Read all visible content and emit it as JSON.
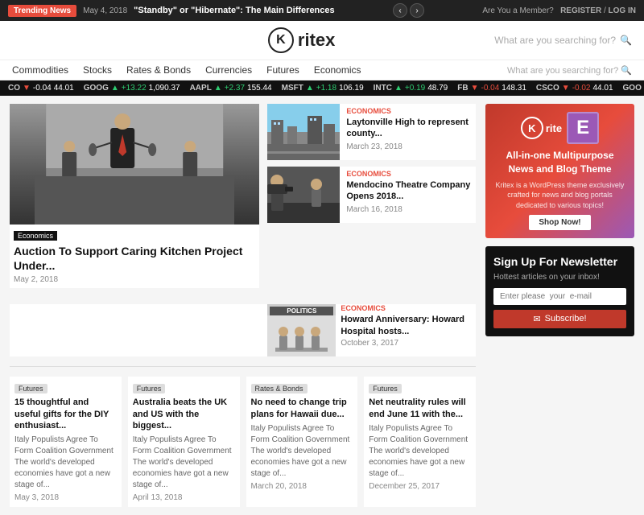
{
  "topbar": {
    "trending_label": "Trending News",
    "date": "May 4, 2018",
    "headline": "\"Standby\" or \"Hibernate\": The Main Differences",
    "member_text": "Are You a Member?",
    "register": "REGISTER",
    "separator": "/",
    "login": "LOG IN"
  },
  "header": {
    "logo_text": "K",
    "logo_name": "ritex",
    "search_placeholder": "What are you searching for?"
  },
  "nav": {
    "links": [
      "Commodities",
      "Stocks",
      "Rates & Bonds",
      "Currencies",
      "Futures",
      "Economics"
    ],
    "search_label": "What are you searching for?"
  },
  "ticker": [
    {
      "sym": "CO",
      "change": "-0.04",
      "val": "44.01",
      "dir": "down"
    },
    {
      "sym": "GOOG",
      "change": "+13.22",
      "val": "1,090.37",
      "dir": "up"
    },
    {
      "sym": "AAPL",
      "change": "+2.37",
      "val": "155.44",
      "dir": "up"
    },
    {
      "sym": "MSFT",
      "change": "+1.18",
      "val": "106.19",
      "dir": "up"
    },
    {
      "sym": "INTC",
      "change": "+0.19",
      "val": "48.79",
      "dir": "up"
    },
    {
      "sym": "FB",
      "change": "-0.04",
      "val": "148.31",
      "dir": "down"
    },
    {
      "sym": "CSCO",
      "change": "-0.02",
      "val": "44.01",
      "dir": "down"
    },
    {
      "sym": "GOO",
      "change": "",
      "val": "",
      "dir": ""
    }
  ],
  "featured_main": {
    "tag": "Economics",
    "title": "Auction To Support Caring Kitchen Project Under...",
    "date": "May 2, 2018"
  },
  "featured_right": [
    {
      "tag": "Economics",
      "title": "Laytonville High to represent county...",
      "date": "March 23, 2018"
    },
    {
      "tag": "Economics",
      "title": "Mendocino Theatre Company Opens 2018...",
      "date": "March 16, 2018"
    }
  ],
  "side_cards": [
    {
      "tag": "Economics",
      "title": "Howard Anniversary: Howard Hospital hosts...",
      "date": "October 3, 2017",
      "has_politics_banner": false
    }
  ],
  "politics_card": {
    "tag": "Economics",
    "title": "Howard Anniversary: Howard Hospital hosts...",
    "date": "October 3, 2017",
    "banner": "POLITICS"
  },
  "small_cards": [
    {
      "tag": "Futures",
      "title": "15 thoughtful and useful gifts for the DIY enthusiast...",
      "desc": "Italy Populists Agree To Form Coalition Government The world's developed economies have got a new stage of...",
      "date": "May 3, 2018"
    },
    {
      "tag": "Futures",
      "title": "Australia beats the UK and US with the biggest...",
      "desc": "Italy Populists Agree To Form Coalition Government The world's developed economies have got a new stage of...",
      "date": "April 13, 2018"
    },
    {
      "tag": "Rates & Bonds",
      "title": "No need to change trip plans for Hawaii due...",
      "desc": "Italy Populists Agree To Form Coalition Government The world's developed economies have got a new stage of...",
      "date": "March 20, 2018"
    },
    {
      "tag": "Futures",
      "title": "Net neutrality rules will end June 11 with the...",
      "desc": "Italy Populists Agree To Form Coalition Government The world's developed economies have got a new stage of...",
      "date": "December 25, 2017"
    }
  ],
  "sidebar": {
    "ad": {
      "logo_text": "K",
      "logo_name": "rite",
      "e_icon": "E",
      "title": "All-in-one Multipurpose News and Blog Theme",
      "desc": "Kritex is a WordPress theme exclusively crafted for news and blog portals dedicated to various topics!",
      "btn": "Shop Now!"
    },
    "newsletter": {
      "title": "Sign Up For Newsletter",
      "subtitle": "Hottest articles on your inbox!",
      "placeholder": "Enter please  your  e-mail",
      "btn_label": "Subscribe!",
      "btn_icon": "✉"
    }
  },
  "colors": {
    "accent": "#e74c3c",
    "dark": "#111111",
    "ad_gradient_start": "#c0392b",
    "ad_gradient_end": "#9b59b6"
  }
}
